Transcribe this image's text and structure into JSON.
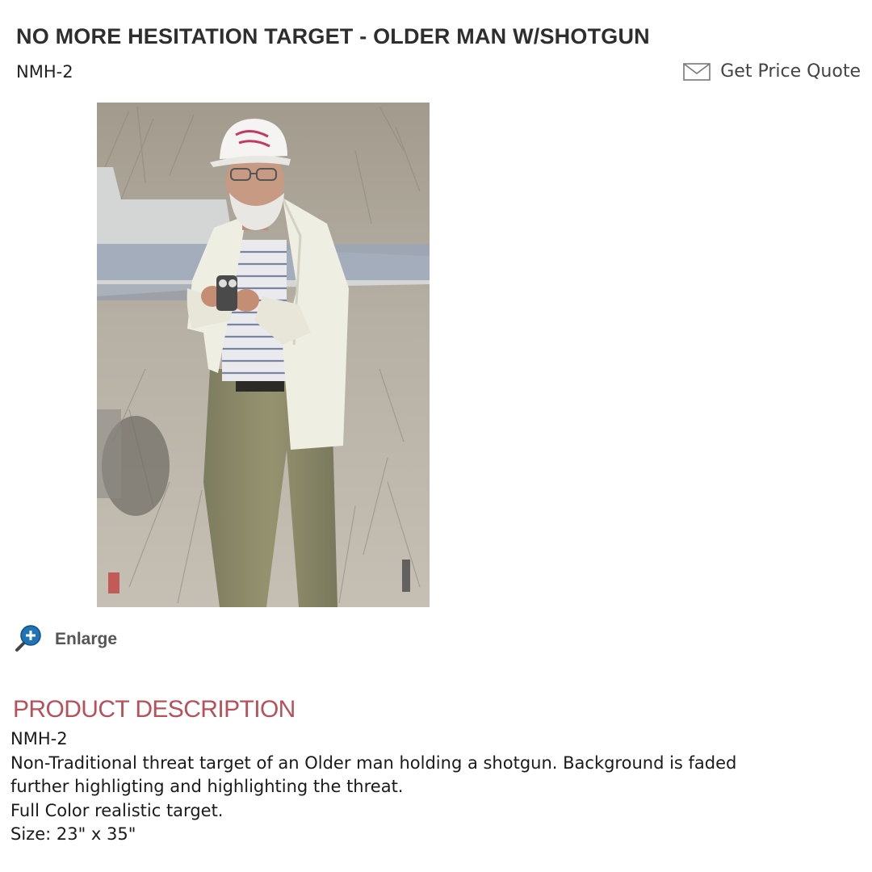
{
  "product": {
    "title": "NO MORE HESITATION TARGET - OLDER MAN W/SHOTGUN",
    "sku": "NMH-2"
  },
  "actions": {
    "quote_label": "Get Price Quote",
    "quote_icon": "envelope-icon",
    "enlarge_label": "Enlarge",
    "enlarge_icon": "magnifier-plus-icon"
  },
  "description": {
    "heading": "PRODUCT DESCRIPTION",
    "lines": [
      "NMH-2",
      "Non-Traditional threat target of an Older man holding a shotgun. Background is faded",
      "further highligting and highlighting the threat.",
      "Full Color realistic target.",
      "Size: 23\" x 35\""
    ]
  },
  "colors": {
    "heading_accent": "#b8505a",
    "enlarge_icon": "#1f74b8"
  }
}
